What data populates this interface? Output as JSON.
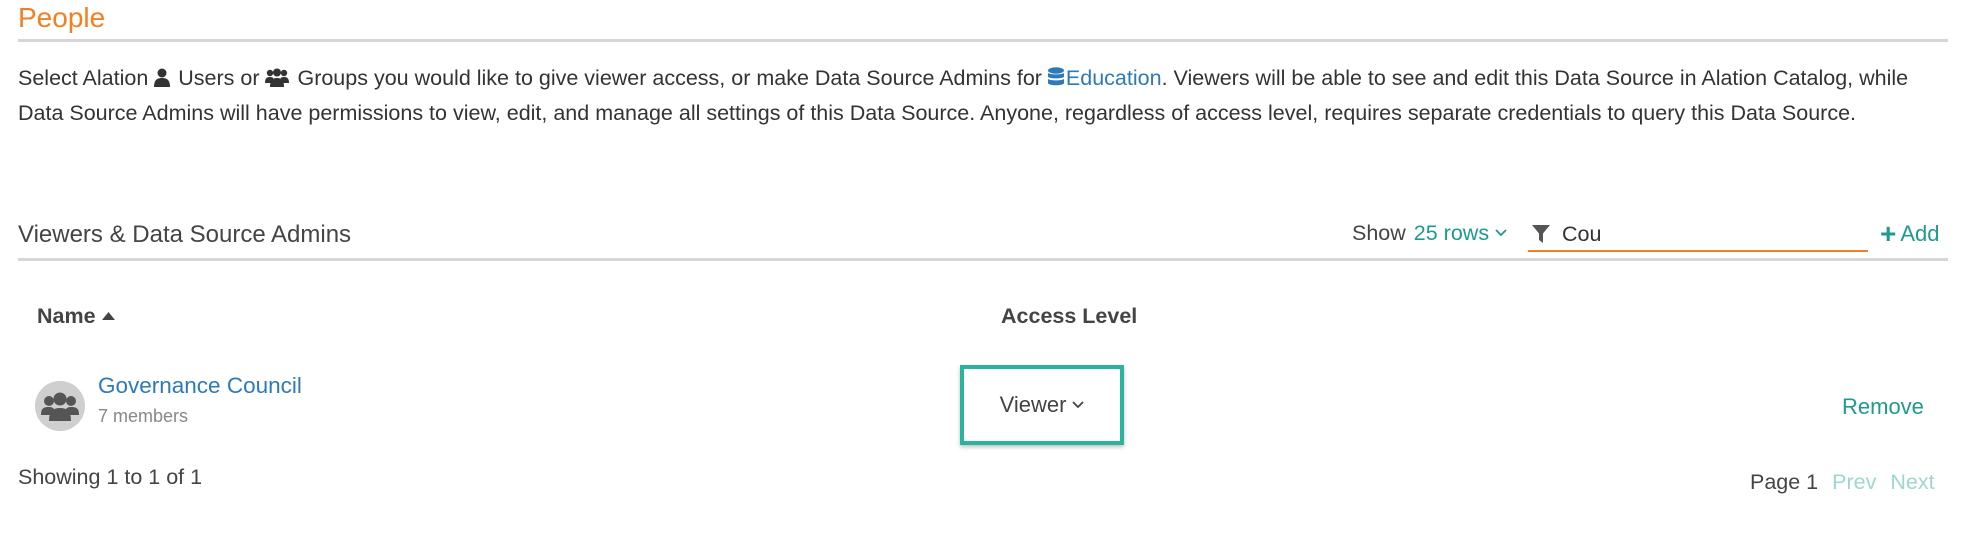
{
  "section": {
    "title": "People"
  },
  "description": {
    "part1": "Select Alation ",
    "users": "Users",
    "part2": " or ",
    "groups": "Groups",
    "part3": " you would like to give viewer access, or make Data Source Admins for ",
    "datasource": "Education",
    "part4": ". Viewers will be able to see and edit this Data Source in Alation Catalog, while Data Source Admins will have permissions to view, edit, and manage all settings of this Data Source. Anyone, regardless of access level, requires separate credentials to query this Data Source."
  },
  "table": {
    "title": "Viewers & Data Source Admins",
    "show_label": "Show",
    "rows_option": "25 rows",
    "filter_value": "Cou",
    "add_label": "Add",
    "columns": {
      "name": "Name",
      "access": "Access Level"
    },
    "rows": [
      {
        "name": "Governance Council",
        "members": "7 members",
        "access": "Viewer",
        "remove": "Remove"
      }
    ],
    "showing": "Showing 1 to 1 of 1",
    "pager": {
      "page": "Page 1",
      "prev": "Prev",
      "next": "Next"
    }
  },
  "colors": {
    "accent_orange": "#F57F20",
    "teal": "#1e9a8e",
    "link_blue": "#2d7ab8",
    "focus_green": "#2bb39e"
  },
  "icons": {
    "user": "user-icon",
    "group": "users-group-icon",
    "database": "database-icon",
    "filter": "filter-icon",
    "plus": "plus-icon",
    "sort": "sort-asc-icon",
    "chevron": "chevron-down-icon"
  }
}
